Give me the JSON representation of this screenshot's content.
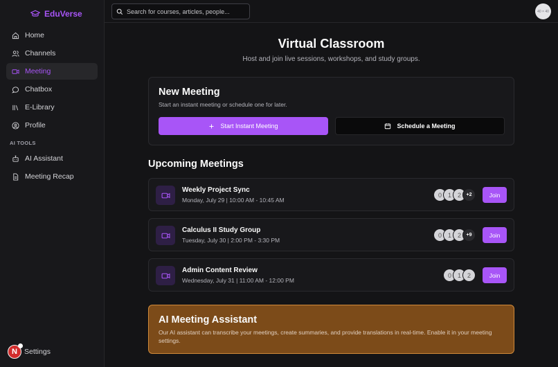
{
  "brand": {
    "name": "EduVerse",
    "icon": "graduation-cap-icon"
  },
  "sidebar": {
    "items": [
      {
        "label": "Home",
        "icon": "home-icon",
        "active": false
      },
      {
        "label": "Channels",
        "icon": "users-icon",
        "active": false
      },
      {
        "label": "Meeting",
        "icon": "video-icon",
        "active": true
      },
      {
        "label": "Chatbox",
        "icon": "chat-bubble-icon",
        "active": false
      },
      {
        "label": "E-Library",
        "icon": "library-icon",
        "active": false
      },
      {
        "label": "Profile",
        "icon": "user-circle-icon",
        "active": false
      }
    ],
    "section_label": "AI TOOLS",
    "ai_items": [
      {
        "label": "AI Assistant",
        "icon": "bot-icon"
      },
      {
        "label": "Meeting Recap",
        "icon": "document-icon"
      }
    ],
    "settings_label": "Settings",
    "avatar_initial": "N"
  },
  "search": {
    "placeholder": "Search for courses, articles, people..."
  },
  "user_avatar_text": "40 × 40",
  "page": {
    "title": "Virtual Classroom",
    "subtitle": "Host and join live sessions, workshops, and study groups."
  },
  "new_meeting": {
    "title": "New Meeting",
    "subtitle": "Start an instant meeting or schedule one for later.",
    "instant_label": "Start Instant Meeting",
    "schedule_label": "Schedule a Meeting"
  },
  "upcoming": {
    "title": "Upcoming Meetings",
    "join_label": "Join",
    "meetings": [
      {
        "title": "Weekly Project Sync",
        "time": "Monday, July 29 | 10:00 AM - 10:45 AM",
        "avatars": [
          "0",
          "1",
          "2"
        ],
        "more": "+2"
      },
      {
        "title": "Calculus II Study Group",
        "time": "Tuesday, July 30 | 2:00 PM - 3:30 PM",
        "avatars": [
          "0",
          "1",
          "2"
        ],
        "more": "+9"
      },
      {
        "title": "Admin Content Review",
        "time": "Wednesday, July 31 | 11:00 AM - 12:00 PM",
        "avatars": [
          "0",
          "1",
          "2"
        ],
        "more": ""
      }
    ]
  },
  "ai_assistant": {
    "title": "AI Meeting Assistant",
    "text": "Our AI assistant can transcribe your meetings, create summaries, and provide translations in real-time. Enable it in your meeting settings."
  },
  "colors": {
    "accent": "#a855f7",
    "ai_card": "#7c4b19",
    "ai_border": "#d18a3a"
  }
}
